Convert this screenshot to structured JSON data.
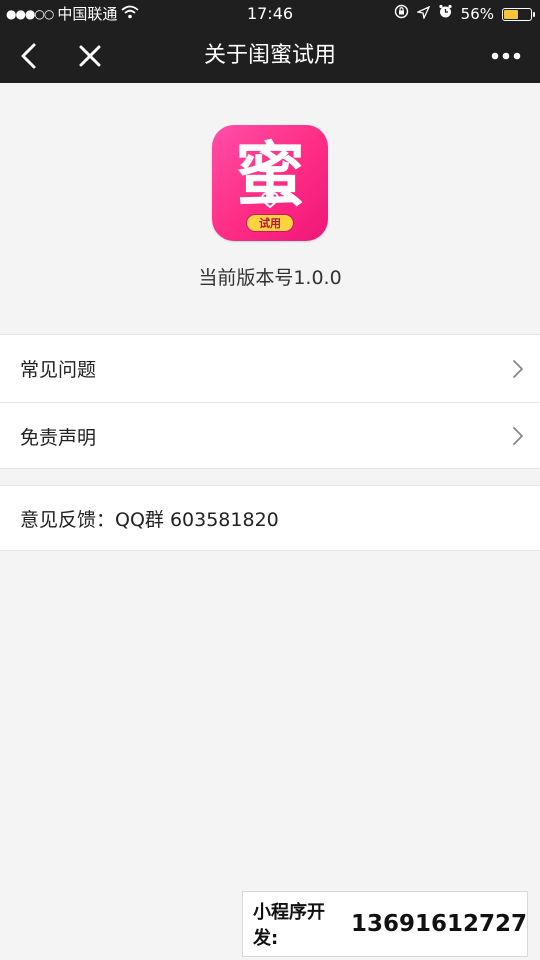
{
  "status_bar": {
    "signal": "●●●○○",
    "carrier": "中国联通",
    "time": "17:46",
    "battery_percent": "56%",
    "battery_level": 0.56
  },
  "nav": {
    "title": "关于闺蜜试用"
  },
  "logo": {
    "char": "蜜",
    "badge": "试用",
    "colors": {
      "gradient_start": "#ff4fa8",
      "gradient_end": "#f0167a",
      "badge": "#ffd23f"
    }
  },
  "version_text": "当前版本号1.0.0",
  "menu": {
    "faq": "常见问题",
    "disclaimer": "免责声明"
  },
  "feedback": {
    "text": "意见反馈：QQ群 603581820"
  },
  "banner": {
    "label": "小程序开发:",
    "phone": "13691612727"
  }
}
